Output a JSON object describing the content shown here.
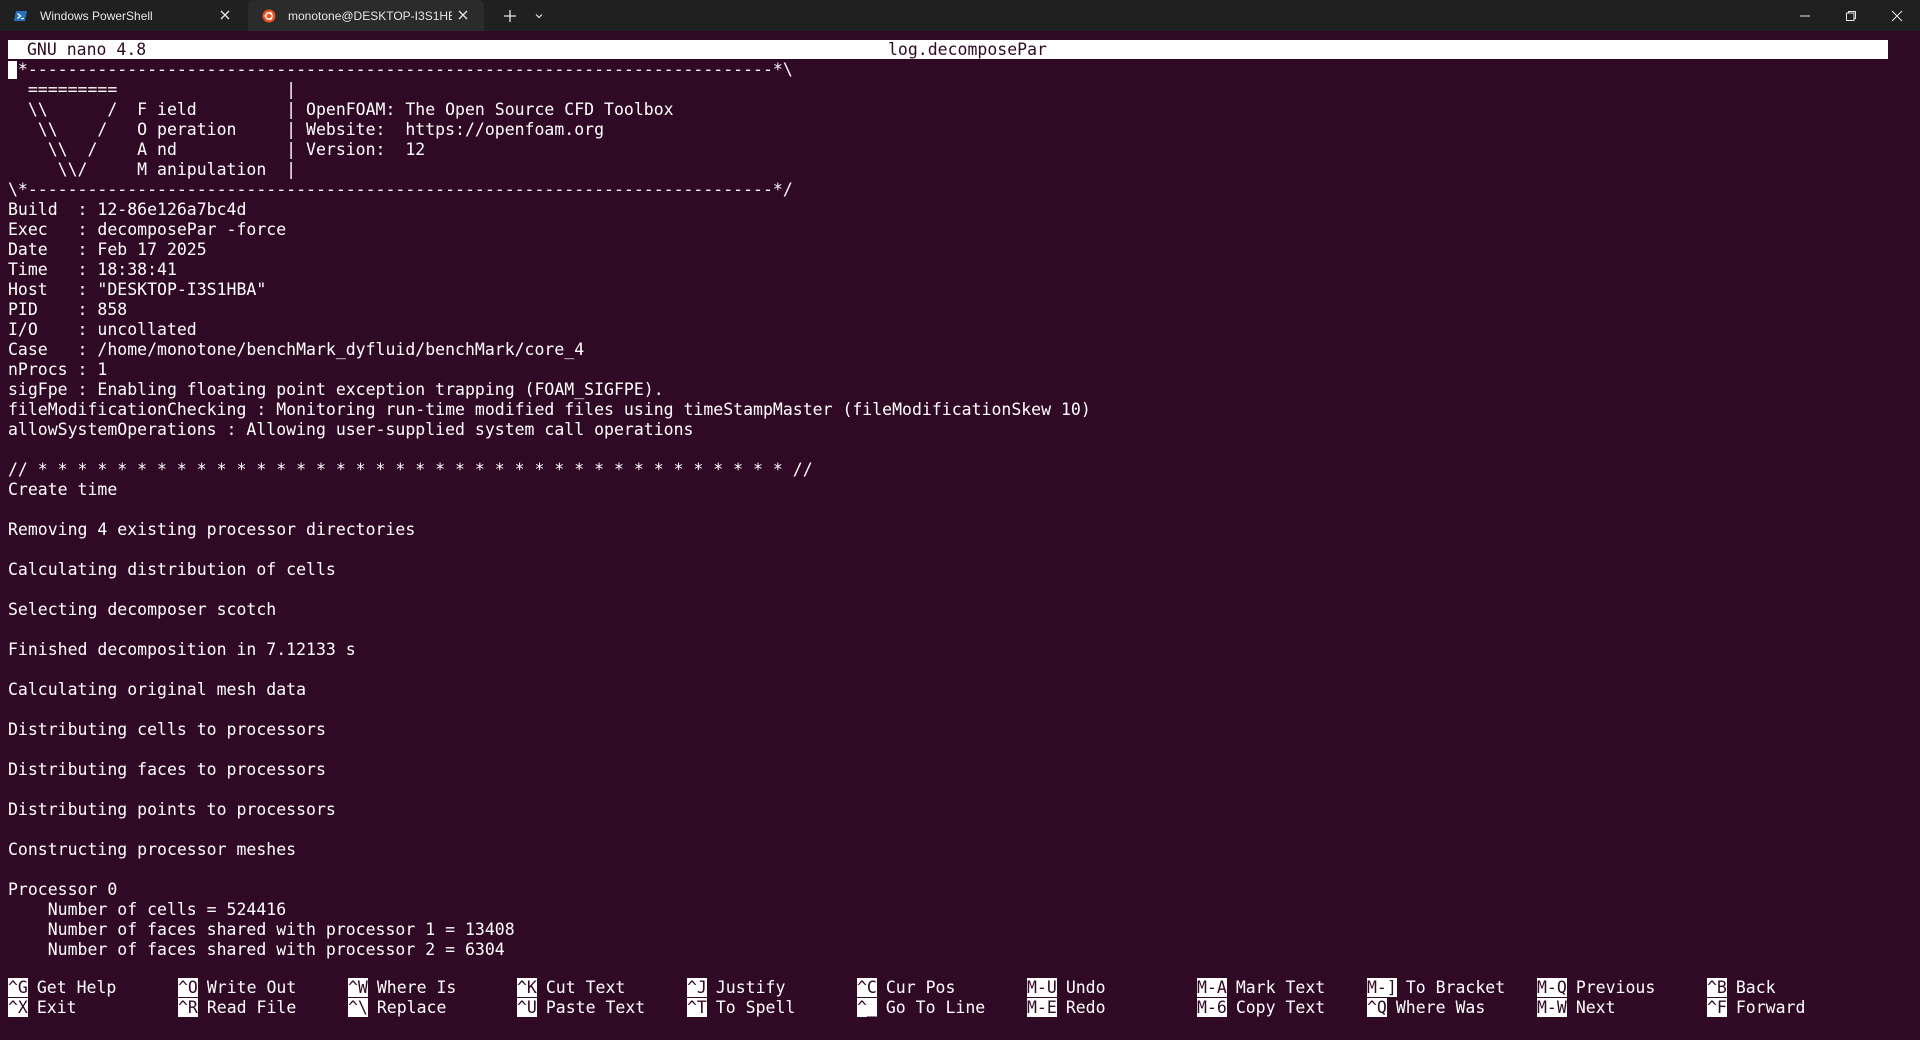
{
  "tabs": [
    {
      "title": "Windows PowerShell",
      "icon": "powershell-icon"
    },
    {
      "title": "monotone@DESKTOP-I3S1HBA",
      "icon": "ubuntu-icon"
    }
  ],
  "nano": {
    "program": "GNU nano 4.8",
    "filename": "log.decomposePar"
  },
  "log_lines": [
    "/*---------------------------------------------------------------------------*\\",
    "  =========                 |",
    "  \\\\      /  F ield         | OpenFOAM: The Open Source CFD Toolbox",
    "   \\\\    /   O peration     | Website:  https://openfoam.org",
    "    \\\\  /    A nd           | Version:  12",
    "     \\\\/     M anipulation  |",
    "\\*---------------------------------------------------------------------------*/",
    "Build  : 12-86e126a7bc4d",
    "Exec   : decomposePar -force",
    "Date   : Feb 17 2025",
    "Time   : 18:38:41",
    "Host   : \"DESKTOP-I3S1HBA\"",
    "PID    : 858",
    "I/O    : uncollated",
    "Case   : /home/monotone/benchMark_dyfluid/benchMark/core_4",
    "nProcs : 1",
    "sigFpe : Enabling floating point exception trapping (FOAM_SIGFPE).",
    "fileModificationChecking : Monitoring run-time modified files using timeStampMaster (fileModificationSkew 10)",
    "allowSystemOperations : Allowing user-supplied system call operations",
    "",
    "// * * * * * * * * * * * * * * * * * * * * * * * * * * * * * * * * * * * * * * //",
    "Create time",
    "",
    "Removing 4 existing processor directories",
    "",
    "Calculating distribution of cells",
    "",
    "Selecting decomposer scotch",
    "",
    "Finished decomposition in 7.12133 s",
    "",
    "Calculating original mesh data",
    "",
    "Distributing cells to processors",
    "",
    "Distributing faces to processors",
    "",
    "Distributing points to processors",
    "",
    "Constructing processor meshes",
    "",
    "Processor 0",
    "    Number of cells = 524416",
    "    Number of faces shared with processor 1 = 13408",
    "    Number of faces shared with processor 2 = 6304"
  ],
  "shortcuts": [
    {
      "key": "^G",
      "label": "Get Help"
    },
    {
      "key": "^X",
      "label": "Exit"
    },
    {
      "key": "^O",
      "label": "Write Out"
    },
    {
      "key": "^R",
      "label": "Read File"
    },
    {
      "key": "^W",
      "label": "Where Is"
    },
    {
      "key": "^\\",
      "label": "Replace"
    },
    {
      "key": "^K",
      "label": "Cut Text"
    },
    {
      "key": "^U",
      "label": "Paste Text"
    },
    {
      "key": "^J",
      "label": "Justify"
    },
    {
      "key": "^T",
      "label": "To Spell"
    },
    {
      "key": "^C",
      "label": "Cur Pos"
    },
    {
      "key": "^_",
      "label": "Go To Line"
    },
    {
      "key": "M-U",
      "label": "Undo"
    },
    {
      "key": "M-E",
      "label": "Redo"
    },
    {
      "key": "M-A",
      "label": "Mark Text"
    },
    {
      "key": "M-6",
      "label": "Copy Text"
    },
    {
      "key": "M-]",
      "label": "To Bracket"
    },
    {
      "key": "^Q",
      "label": "Where Was"
    },
    {
      "key": "M-Q",
      "label": "Previous"
    },
    {
      "key": "M-W",
      "label": "Next"
    },
    {
      "key": "^B",
      "label": "Back"
    },
    {
      "key": "^F",
      "label": "Forward"
    }
  ],
  "colors": {
    "terminal_bg": "#300a24",
    "terminal_fg": "#ffffff",
    "tabbar_bg": "#202020",
    "active_tab_bg": "#2b2b2b"
  }
}
